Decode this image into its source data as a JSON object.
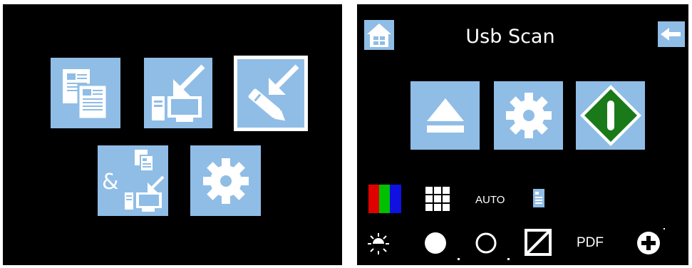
{
  "left_menu": {
    "items": [
      {
        "icon": "copy-icon"
      },
      {
        "icon": "scan-to-pc-icon"
      },
      {
        "icon": "scan-to-pen-icon",
        "selected": true
      },
      {
        "icon": "copy-and-scan-icon",
        "label": "&"
      },
      {
        "icon": "gear-icon"
      }
    ]
  },
  "usb_scan": {
    "title": "Usb Scan",
    "home_icon": "home-icon",
    "back_icon": "back-arrow-icon",
    "actions": [
      {
        "icon": "eject-icon"
      },
      {
        "icon": "gear-icon"
      },
      {
        "icon": "start-icon",
        "color": "#1a7a1a"
      }
    ],
    "status": {
      "auto_label": "AUTO",
      "format_label": "PDF"
    },
    "colors": {
      "tile": "#8fbde6",
      "red": "#e00000",
      "green": "#00c000",
      "blue": "#1010e0"
    }
  }
}
